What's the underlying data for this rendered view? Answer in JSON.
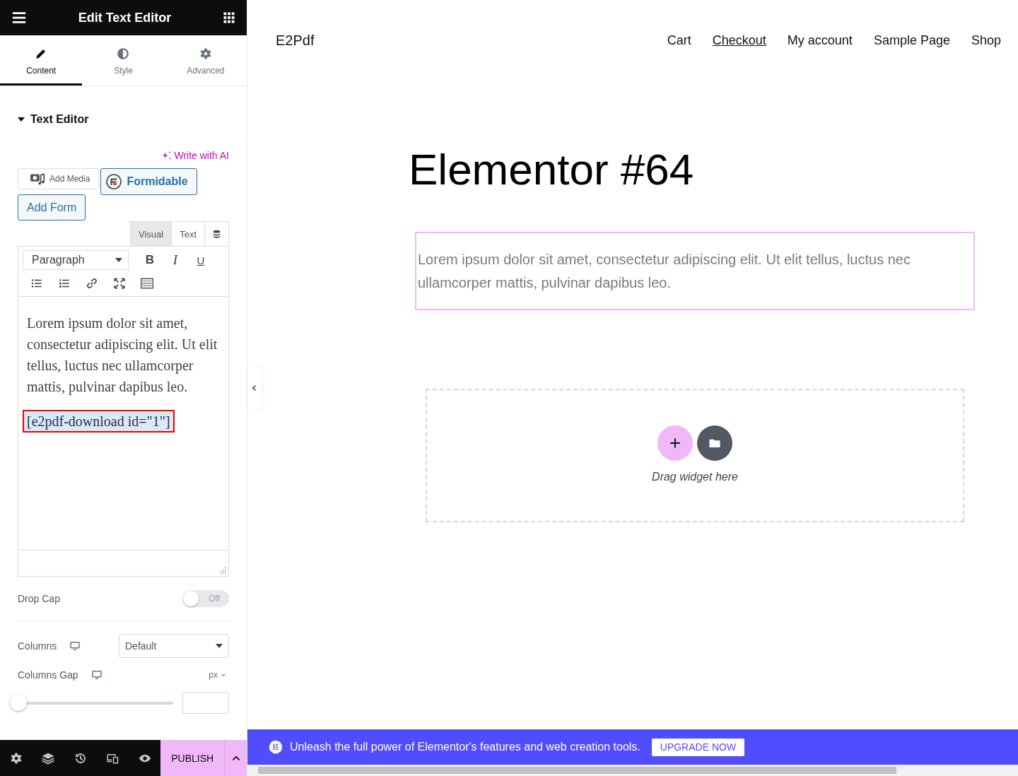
{
  "panel": {
    "title": "Edit Text Editor",
    "tabs": [
      {
        "label": "Content",
        "kind": "pencil",
        "selected": true
      },
      {
        "label": "Style",
        "kind": "contrast",
        "selected": false
      },
      {
        "label": "Advanced",
        "kind": "gear",
        "selected": false
      }
    ],
    "section": {
      "title": "Text Editor",
      "expanded": true
    },
    "ai_link": "Write with AI",
    "media_buttons": [
      {
        "label": "Add Media",
        "kind": "media"
      },
      {
        "label": "Formidable",
        "kind": "formidable"
      },
      {
        "label": "Add Form",
        "kind": "form"
      }
    ],
    "editor_tabs": [
      {
        "label": "Visual",
        "selected": true
      },
      {
        "label": "Text",
        "selected": false
      }
    ],
    "format_select": "Paragraph",
    "format_buttons": [
      {
        "label": "B",
        "kind": "bold"
      },
      {
        "label": "I",
        "kind": "italic"
      },
      {
        "label": "U",
        "kind": "underline"
      }
    ],
    "content": {
      "paragraph": "Lorem ipsum dolor sit amet, consectetur adipiscing elit. Ut elit tellus, luctus nec ullamcorper mattis, pulvinar dapibus leo.",
      "shortcode": "[e2pdf-download id=\"1\"]"
    },
    "drop_cap": {
      "label": "Drop Cap",
      "on": false,
      "state_text": "Off"
    },
    "columns": {
      "label": "Columns",
      "value": "Default"
    },
    "columns_gap": {
      "label": "Columns Gap",
      "unit": "px",
      "level": 0
    },
    "publish": "PUBLISH"
  },
  "site": {
    "brand": "E2Pdf",
    "nav": [
      {
        "label": "Cart",
        "selected": false
      },
      {
        "label": "Checkout",
        "selected": true
      },
      {
        "label": "My account",
        "selected": false
      },
      {
        "label": "Sample Page",
        "selected": false
      },
      {
        "label": "Shop",
        "selected": false
      }
    ],
    "heading": "Elementor #64",
    "text_widget": {
      "text": "Lorem ipsum dolor sit amet, consectetur adipiscing elit. Ut elit tellus, luctus nec ullamcorper mattis, pulvinar dapibus leo.",
      "selected": true
    },
    "drop_zone": {
      "hint": "Drag widget here"
    }
  },
  "banner": {
    "text": "Unleash the full power of Elementor's features and web creation tools.",
    "button": "UPGRADE NOW"
  }
}
